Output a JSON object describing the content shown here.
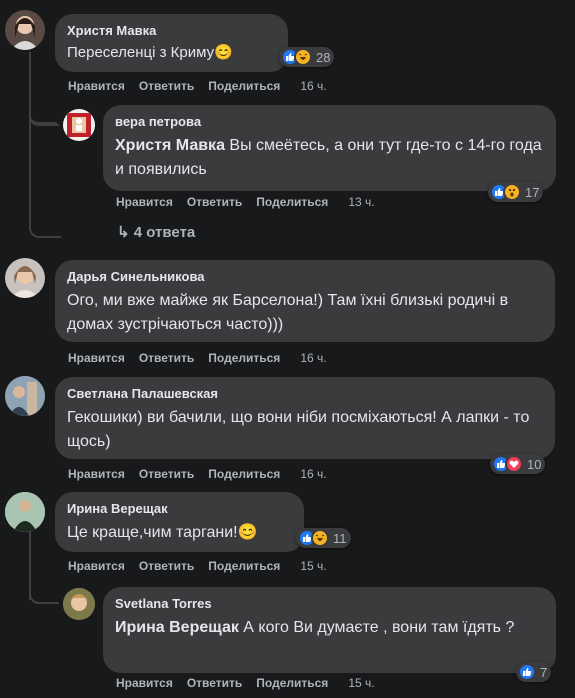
{
  "actions": {
    "like": "Нравится",
    "reply": "Ответить",
    "share": "Поделиться"
  },
  "comments": [
    {
      "author": "Христя Мавка",
      "text": "Переселенці з Криму😊",
      "time": "16 ч.",
      "reactions_count": "28"
    },
    {
      "author": "вера петрова",
      "mention": "Христя Мавка",
      "text": " Вы смеётесь, а они тут где-то с 14-го года и появились",
      "time": "13 ч.",
      "reactions_count": "17"
    },
    {
      "author": "Дарья Синельникова",
      "text": "Ого, ми вже майже як Барселона!) Там їхні близькі родичі в домах зустрічаються часто)))",
      "time": "16 ч."
    },
    {
      "author": "Светлана Палашевская",
      "text": "Гекошики) ви бачили, що вони ніби посміхаються! А лапки - то щось)",
      "time": "16 ч.",
      "reactions_count": "10"
    },
    {
      "author": "Ирина Верещак",
      "text": "Це краще,чим таргани!😊",
      "time": "15 ч.",
      "reactions_count": "11"
    },
    {
      "author": "Svetlana Torres",
      "mention": "Ирина Верещак",
      "text": " А кого Ви думаєте , вони там їдять ?",
      "time": "15 ч.",
      "reactions_count": "7"
    }
  ],
  "replies_link": "4 ответа",
  "colors": {
    "bg": "#18191a",
    "bubble": "#3a3b3c",
    "like": "#2078f4",
    "heart": "#f33e58",
    "haha": "#f7b125"
  }
}
